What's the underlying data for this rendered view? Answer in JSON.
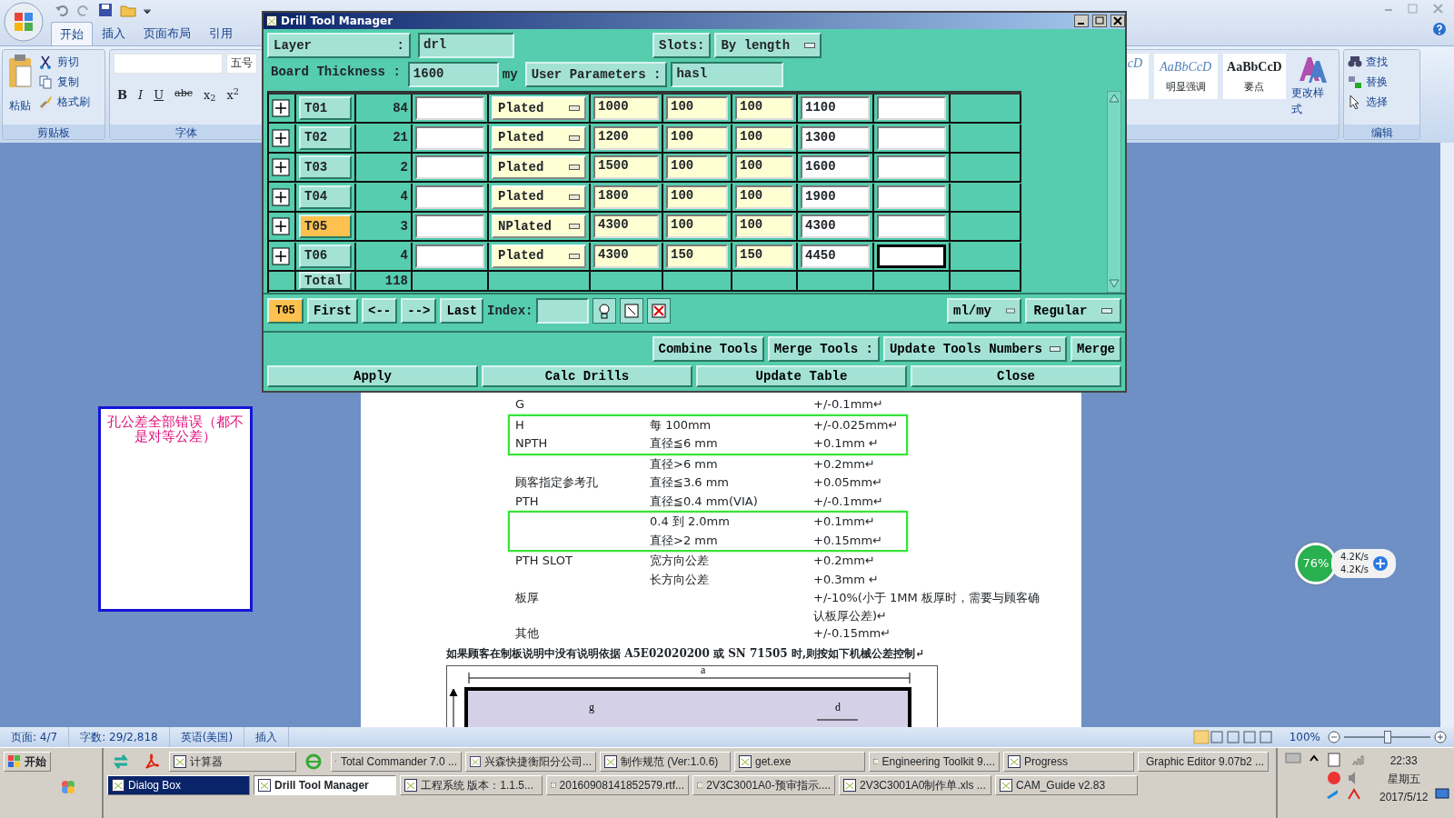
{
  "word": {
    "tabs": [
      {
        "label": "开始",
        "selected": true
      },
      {
        "label": "插入",
        "selected": false
      },
      {
        "label": "页面布局",
        "selected": false
      },
      {
        "label": "引用",
        "selected": false
      }
    ],
    "clipboard": {
      "paste": "粘贴",
      "items": [
        "剪切",
        "复制",
        "格式刷"
      ],
      "group": "剪贴板"
    },
    "font": {
      "size": "五号",
      "buttons": [
        "B",
        "I",
        "U",
        "abc",
        "x$_{2}$",
        "x$^{2}$"
      ],
      "group": "字体"
    },
    "styles": [
      {
        "sample": "cD",
        "kind": "italic"
      },
      {
        "sample": "AaBbCcD",
        "label": "明显强调",
        "kind": "italic"
      },
      {
        "sample": "AaBbCcD",
        "label": "要点",
        "kind": "bold"
      }
    ],
    "change_styles": "更改样式",
    "editing": {
      "items": [
        "查找",
        "替换",
        "选择"
      ],
      "group": "编辑"
    }
  },
  "dialog": {
    "title": "Drill Tool Manager",
    "layer": {
      "label": "Layer :",
      "value": "drl"
    },
    "slots": {
      "label": "Slots:",
      "value": "By length"
    },
    "board": {
      "label": "Board Thickness :",
      "value": "1600",
      "unit": "my"
    },
    "user": {
      "label": "User Parameters :",
      "value": "hasl"
    },
    "rows": [
      {
        "tool": "T01",
        "count": "84",
        "type": "Plated",
        "col_5": "1000",
        "col_6": "100",
        "col_7": "100",
        "col_8": "1100",
        "selected": false,
        "focused": false
      },
      {
        "tool": "T02",
        "count": "21",
        "type": "Plated",
        "col_5": "1200",
        "col_6": "100",
        "col_7": "100",
        "col_8": "1300",
        "selected": false,
        "focused": false
      },
      {
        "tool": "T03",
        "count": "2",
        "type": "Plated",
        "col_5": "1500",
        "col_6": "100",
        "col_7": "100",
        "col_8": "1600",
        "selected": false,
        "focused": false
      },
      {
        "tool": "T04",
        "count": "4",
        "type": "Plated",
        "col_5": "1800",
        "col_6": "100",
        "col_7": "100",
        "col_8": "1900",
        "selected": false,
        "focused": false
      },
      {
        "tool": "T05",
        "count": "3",
        "type": "NPlated",
        "col_5": "4300",
        "col_6": "100",
        "col_7": "100",
        "col_8": "4300",
        "selected": true,
        "focused": false
      },
      {
        "tool": "T06",
        "count": "4",
        "type": "Plated",
        "col_5": "4300",
        "col_6": "150",
        "col_7": "150",
        "col_8": "4450",
        "selected": false,
        "focused": true
      }
    ],
    "total": {
      "label": "Total",
      "count": "118"
    },
    "current": "T05",
    "nav": [
      "First",
      "<--",
      "-->",
      "Last"
    ],
    "index_label": "Index:",
    "units": "ml/my",
    "mode": "Regular",
    "combine": "Combine Tools",
    "merge_label": "Merge Tools :",
    "merge_mode": "Update Tools Numbers",
    "merge": "Merge",
    "actions": [
      "Apply",
      "Calc Drills",
      "Update Table",
      "Close"
    ]
  },
  "note": "孔公差全部错误（都不是对等公差）",
  "document": {
    "rows": [
      {
        "c1": "G",
        "c2": "",
        "c3": "+/-0.1mm↵",
        "boxed": false
      },
      {
        "c1": "H",
        "c2": "每 100mm",
        "c3": "+/-0.025mm↵",
        "boxed": true
      },
      {
        "c1": "NPTH",
        "c2": "直径≦6 mm",
        "c3": "+0.1mm  ↵",
        "boxed": true
      },
      {
        "c1": "",
        "c2": "直径>6 mm",
        "c3": "+0.2mm↵",
        "boxed": false
      },
      {
        "c1": "顾客指定参考孔",
        "c2": "直径≦3.6 mm",
        "c3": "+0.05mm↵",
        "boxed": false
      },
      {
        "c1": "PTH",
        "c2": "直径≦0.4 mm(VIA)",
        "c3": "+/-0.1mm↵",
        "boxed": false
      },
      {
        "c1": "",
        "c2": "0.4 到 2.0mm",
        "c3": "+0.1mm↵",
        "boxed": true
      },
      {
        "c1": "",
        "c2": "直径>2 mm",
        "c3": "+0.15mm↵",
        "boxed": true
      },
      {
        "c1": "PTH SLOT",
        "c2": "宽方向公差",
        "c3": "+0.2mm↵",
        "boxed": false
      },
      {
        "c1": "",
        "c2": "长方向公差",
        "c3": "+0.3mm        ↵",
        "boxed": false
      },
      {
        "c1": "板厚",
        "c2": "",
        "c3": "+/-10%(小于  1MM  板厚时，需要与顾客确认板厚公差)↵",
        "boxed": false
      },
      {
        "c1": "其他",
        "c2": "",
        "c3": "+/-0.15mm↵",
        "boxed": false
      }
    ],
    "heading": "如果顾客在制板说明中没有说明依据 A5E02020200 或   SN 71505 时,则按如下机械公差控制↵",
    "diagram_labels": [
      "a",
      "d",
      "g"
    ]
  },
  "net_widget": {
    "percent": "76%",
    "up": "4.2K/s",
    "down": "4.2K/s"
  },
  "status_bar": {
    "items": [
      "页面: 4/7",
      "字数: 29/2,818",
      "英语(美国)",
      "插入"
    ],
    "zoom": "100%",
    "level": 0.5
  },
  "taskbar": {
    "start": "开始",
    "row1": [
      {
        "label": "计算器",
        "selected": false,
        "flashing": false
      },
      {
        "label": "Total Commander 7.0 ...",
        "selected": false,
        "flashing": false
      },
      {
        "label": "兴森快捷衡阳分公司...",
        "selected": false,
        "flashing": false
      },
      {
        "label": "制作规范 (Ver:1.0.6)",
        "selected": false,
        "flashing": false
      },
      {
        "label": "get.exe",
        "selected": false,
        "flashing": false
      },
      {
        "label": "Engineering Toolkit 9....",
        "selected": false,
        "flashing": false
      },
      {
        "label": "Progress",
        "selected": false,
        "flashing": false
      },
      {
        "label": "Graphic Editor 9.07b2 ...",
        "selected": false,
        "flashing": false
      }
    ],
    "row2": [
      {
        "label": "Dialog Box",
        "selected": false,
        "flashing": true
      },
      {
        "label": "Drill Tool Manager",
        "selected": true,
        "flashing": false
      },
      {
        "label": "工程系统  版本：1.1.5...",
        "selected": false,
        "flashing": false
      },
      {
        "label": "20160908141852579.rtf...",
        "selected": false,
        "flashing": false
      },
      {
        "label": "2V3C3001A0-预审指示....",
        "selected": false,
        "flashing": false
      },
      {
        "label": "2V3C3001A0制作单.xls ...",
        "selected": false,
        "flashing": false
      },
      {
        "label": "CAM_Guide v2.83",
        "selected": false,
        "flashing": false
      }
    ],
    "clock": {
      "time": "22:33",
      "day": "星期五",
      "date": "2017/5/12"
    }
  }
}
